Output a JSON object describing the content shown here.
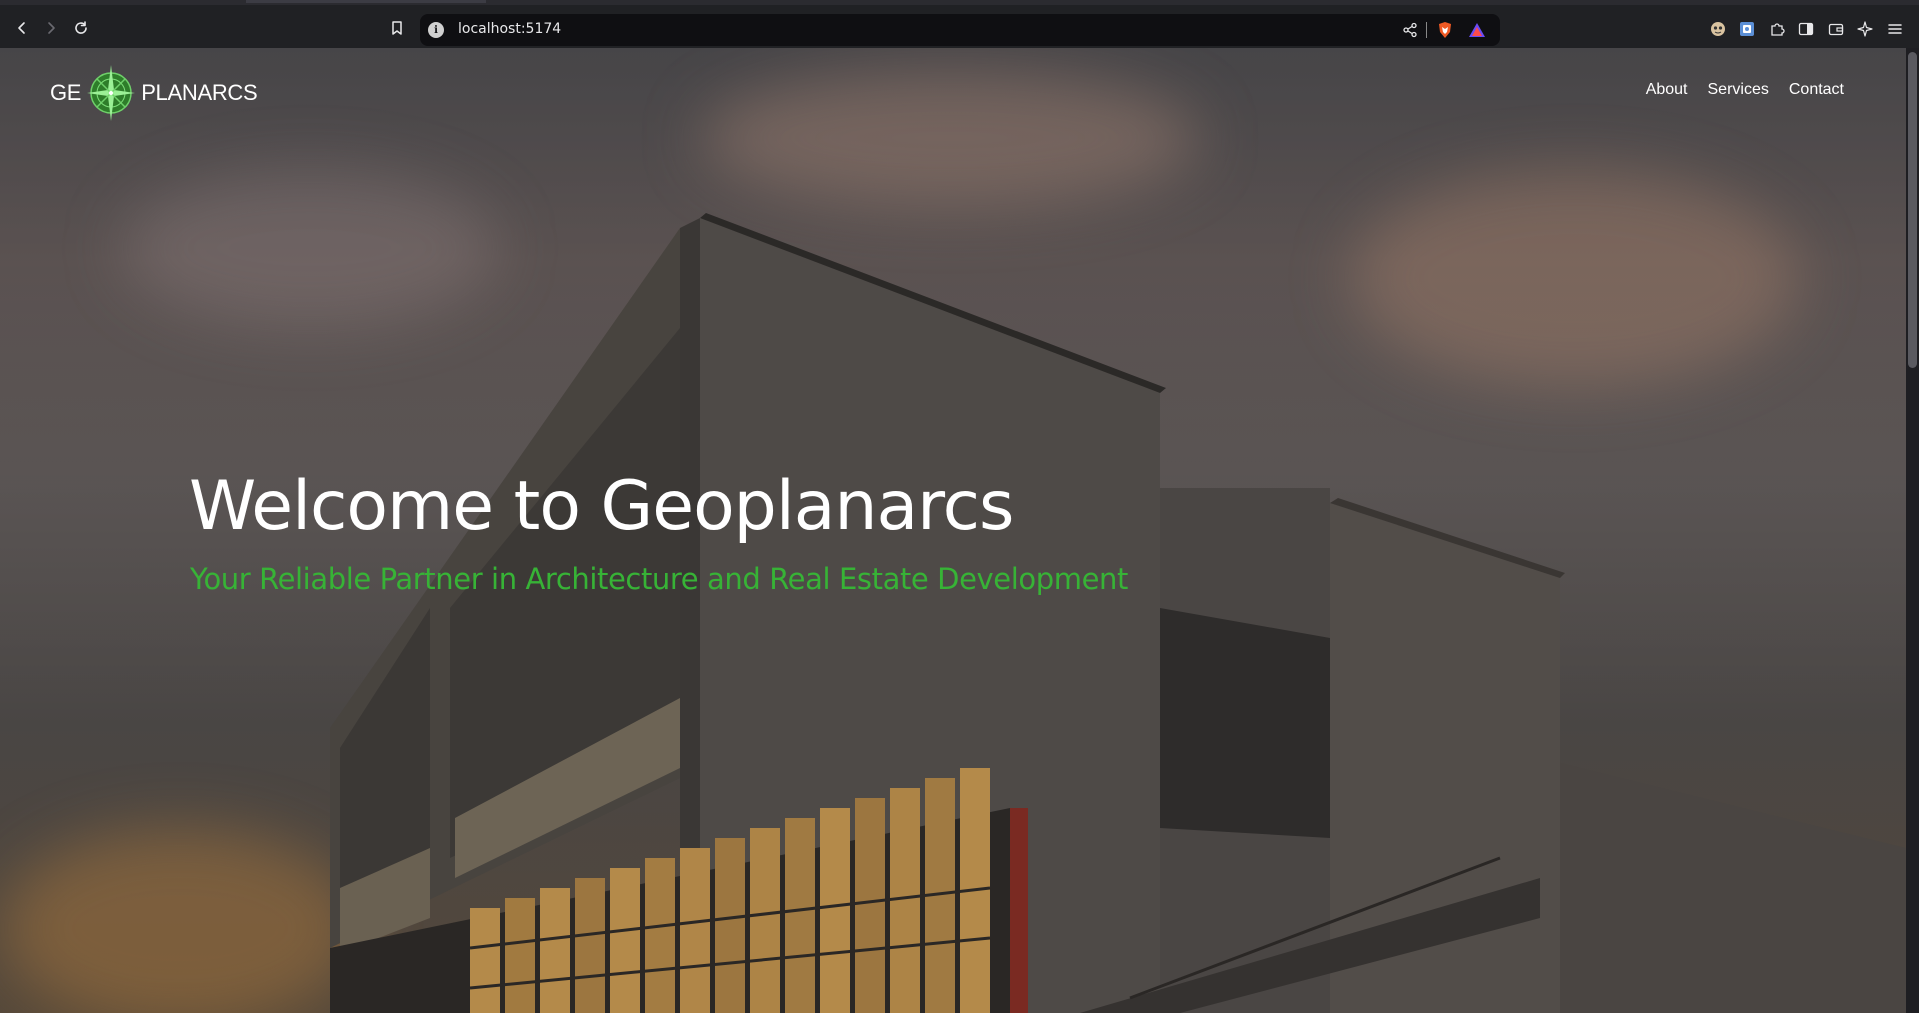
{
  "browser": {
    "url": "localhost:5174",
    "info_icon": "info-icon",
    "toolbar_icons": [
      "back-icon",
      "forward-icon",
      "reload-icon",
      "bookmark-icon",
      "share-icon",
      "brave-shield-icon",
      "brave-rewards-icon"
    ],
    "extension_icons": [
      "profile-avatar-icon",
      "extension-app-icon",
      "extensions-puzzle-icon",
      "sidebar-icon",
      "wallet-icon",
      "leo-ai-icon",
      "menu-icon"
    ]
  },
  "header": {
    "logo_left": "GE",
    "logo_right": "PLANARCS",
    "logo_icon": "compass-icon",
    "nav": [
      "About",
      "Services",
      "Contact"
    ]
  },
  "hero": {
    "title": "Welcome to Geoplanarcs",
    "subtitle": "Your Reliable Partner in Architecture and Real Estate Development"
  },
  "colors": {
    "accent": "#37b336",
    "text": "#ffffff",
    "chrome": "#202124"
  }
}
